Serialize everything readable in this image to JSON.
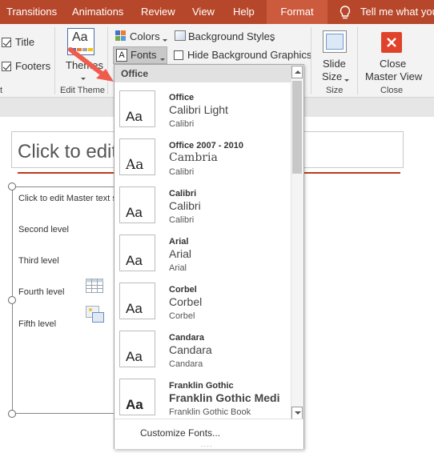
{
  "tabs": {
    "transitions": "Transitions",
    "animations": "Animations",
    "review": "Review",
    "view": "View",
    "help": "Help",
    "format": "Format",
    "tell_me": "Tell me what you"
  },
  "ribbon": {
    "title_check": "Title",
    "footers_check": "Footers",
    "themes_label": "Themes",
    "edit_theme_group": "Edit Theme",
    "colors_label": "Colors",
    "fonts_label": "Fonts",
    "background_styles_label": "Background Styles",
    "hide_background_label": "Hide Background Graphics",
    "slide_size_label_1": "Slide",
    "slide_size_label_2": "Size",
    "size_group": "Size",
    "close_label_1": "Close",
    "close_label_2": "Master View",
    "close_group": "Close"
  },
  "slide": {
    "title_placeholder": "Click to edit",
    "level1": "Click to edit Master text s",
    "level2": "Second level",
    "level3": "Third level",
    "level4": "Fourth level",
    "level5": "Fifth level"
  },
  "dropdown": {
    "header": "Office",
    "items": [
      {
        "name": "Office",
        "heading": "Calibri Light",
        "body": "Calibri"
      },
      {
        "name": "Office 2007 - 2010",
        "heading": "Cambria",
        "body": "Calibri"
      },
      {
        "name": "Calibri",
        "heading": "Calibri",
        "body": "Calibri"
      },
      {
        "name": "Arial",
        "heading": "Arial",
        "body": "Arial"
      },
      {
        "name": "Corbel",
        "heading": "Corbel",
        "body": "Corbel"
      },
      {
        "name": "Candara",
        "heading": "Candara",
        "body": "Candara"
      },
      {
        "name": "Franklin Gothic",
        "heading": "Franklin Gothic Medi",
        "body": "Franklin Gothic Book"
      }
    ],
    "thumb_glyph": "Aa",
    "customize": "Customize Fonts..."
  },
  "colors": {
    "accent": "#b7472a",
    "arrow": "#ef5b4c",
    "close_red": "#e0432c"
  }
}
